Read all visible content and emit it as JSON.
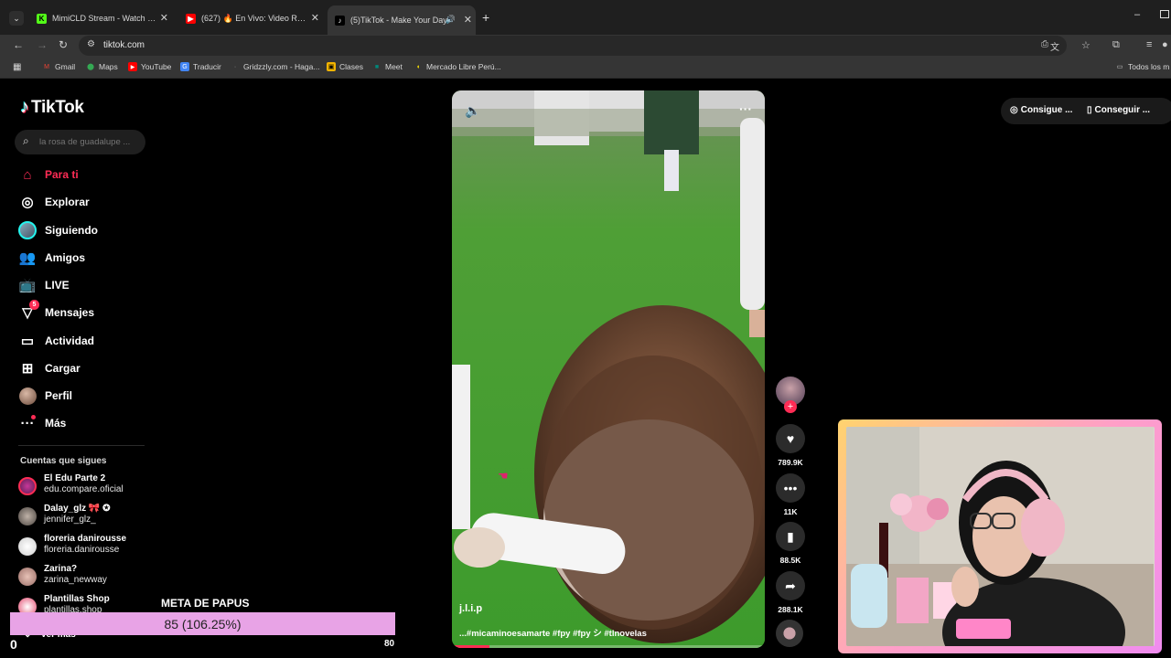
{
  "browser": {
    "tabs": [
      {
        "title": "MimiCLD Stream - Watch Live on",
        "icon": "kick-icon"
      },
      {
        "title": "(627) 🔥 En Vivo: Video Reacción",
        "icon": "youtube-icon"
      },
      {
        "title": "(5)TikTok - Make Your Day",
        "icon": "tiktok-icon",
        "active": true
      }
    ],
    "url": "tiktok.com",
    "bookmarks": [
      "Gmail",
      "Maps",
      "YouTube",
      "Traducir",
      "Gridzzly.com - Haga...",
      "Clases",
      "Meet",
      "Mercado Libre Perú..."
    ],
    "bookmarks_folder": "Todos los m"
  },
  "tiktok": {
    "logo": "TikTok",
    "search_placeholder": "la rosa de guadalupe ...",
    "nav": [
      {
        "label": "Para ti",
        "icon": "home-icon",
        "active": true
      },
      {
        "label": "Explorar",
        "icon": "compass-icon"
      },
      {
        "label": "Siguiendo",
        "icon": "following-avatar-icon"
      },
      {
        "label": "Amigos",
        "icon": "friends-icon"
      },
      {
        "label": "LIVE",
        "icon": "live-tv-icon"
      },
      {
        "label": "Mensajes",
        "icon": "messages-icon",
        "badge": "5"
      },
      {
        "label": "Actividad",
        "icon": "activity-icon"
      },
      {
        "label": "Cargar",
        "icon": "upload-icon"
      },
      {
        "label": "Perfil",
        "icon": "profile-avatar-icon"
      },
      {
        "label": "Más",
        "icon": "more-icon"
      }
    ],
    "following_header": "Cuentas que sigues",
    "following": [
      {
        "name": "El Edu Parte 2 ",
        "handle": "edu.compare.oficial"
      },
      {
        "name": "Dalay_glz 🎀 ✪",
        "handle": "jennifer_glz_"
      },
      {
        "name": "floreria danirousse",
        "handle": "floreria.danirousse"
      },
      {
        "name": "Zarina?",
        "handle": "zarina_newway"
      },
      {
        "name": "Plantillas Shop",
        "handle": "plantillas.shop"
      }
    ],
    "see_more": "Ver más",
    "top_buttons": [
      "Consigue ...",
      "Conseguir ..."
    ],
    "video": {
      "author": "j.l.i.p",
      "caption": "...#micaminoesamarte #fpy #fpy シ #tlnovelas",
      "progress": 0.12
    },
    "actions": [
      {
        "icon": "heart-icon",
        "count": "789.9K"
      },
      {
        "icon": "comment-icon",
        "count": "11K"
      },
      {
        "icon": "bookmark-icon",
        "count": "88.5K"
      },
      {
        "icon": "share-icon",
        "count": "288.1K"
      }
    ]
  },
  "overlay": {
    "goal_title": "META DE PAPUS",
    "goal_text": "85 (106.25%)",
    "goal_min": "0",
    "goal_max": "80",
    "goal_progress": 1.0625
  },
  "colors": {
    "accent": "#fe2c55",
    "goal_bar": "#e8a3e6",
    "cam_border_start": "#ffd36e",
    "cam_border_end": "#f08cf0"
  }
}
